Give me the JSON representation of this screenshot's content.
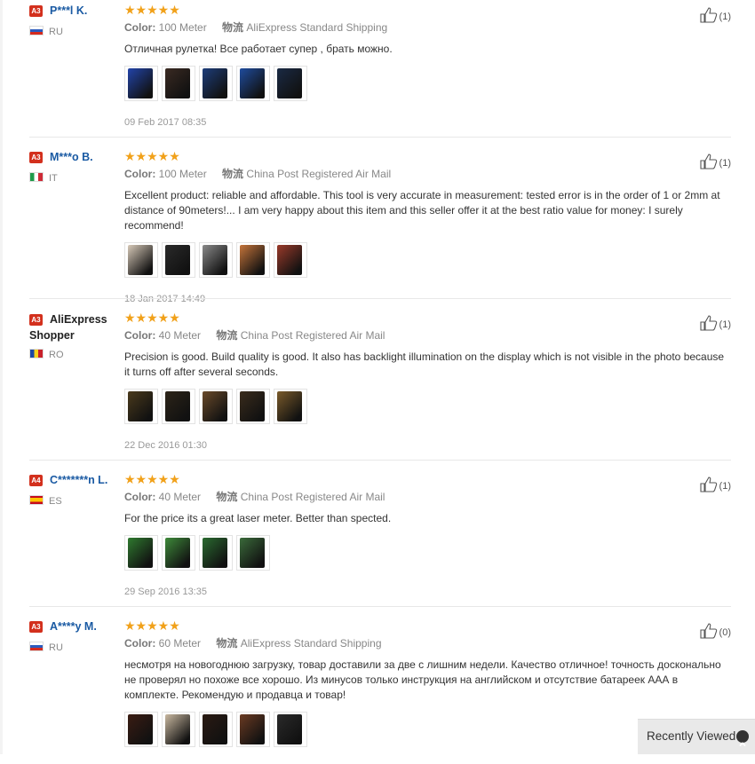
{
  "colors": {
    "star": "#f1a11a",
    "badge": "#d3301d",
    "name": "#1a5aa3",
    "muted": "#888888"
  },
  "reviews": [
    {
      "level": "A3",
      "name": "P***l K.",
      "country": "RU",
      "stars": "★★★★★",
      "color_label": "Color:",
      "color_value": "100 Meter",
      "ship_label": "物流",
      "ship_value": "AliExpress Standard Shipping",
      "text": "Отличная рулетка! Все работает супер , брать можно.",
      "photos": [
        "#2244aa",
        "#3a2a22",
        "#1d3d7a",
        "#1f4c9e",
        "#1a2a44"
      ],
      "date": "09 Feb 2017 08:35",
      "helpful": "(1)"
    },
    {
      "level": "A3",
      "name": "M***o B.",
      "country": "IT",
      "stars": "★★★★★",
      "color_label": "Color:",
      "color_value": "100 Meter",
      "ship_label": "物流",
      "ship_value": "China Post Registered Air Mail",
      "text": "Excellent product: reliable and affordable. This tool is very accurate in measurement: tested error is in the order of 1 or 2mm at distance of 90meters!... I am very happy about this item and this seller offer it at the best ratio value for money: I surely recommend!",
      "photos": [
        "#d7c9b8",
        "#2a2a2a",
        "#8a8a8a",
        "#c4743a",
        "#9a3a2a"
      ],
      "date": "18 Jan 2017 14:49",
      "helpful": "(1)"
    },
    {
      "level": "A3",
      "name": "AliExpress Shopper",
      "country": "RO",
      "stars": "★★★★★",
      "color_label": "Color:",
      "color_value": "40 Meter",
      "ship_label": "物流",
      "ship_value": "China Post Registered Air Mail",
      "text": "Precision is good. Build quality is good. It also has backlight illumination on the display which is not visible in the photo because it turns off after several seconds.",
      "photos": [
        "#4a3a1c",
        "#2c2418",
        "#6a4a2a",
        "#3a2c1c",
        "#7a5a2a"
      ],
      "date": "22 Dec 2016 01:30",
      "helpful": "(1)"
    },
    {
      "level": "A4",
      "name": "C*******n L.",
      "country": "ES",
      "stars": "★★★★★",
      "color_label": "Color:",
      "color_value": "40 Meter",
      "ship_label": "物流",
      "ship_value": "China Post Registered Air Mail",
      "text": "For the price its a great laser meter. Better than spected.",
      "photos": [
        "#2f7a2f",
        "#3e8a3a",
        "#2a6a30",
        "#3a6a3a"
      ],
      "date": "29 Sep 2016 13:35",
      "helpful": "(1)"
    },
    {
      "level": "A3",
      "name": "A****y M.",
      "country": "RU",
      "stars": "★★★★★",
      "color_label": "Color:",
      "color_value": "60 Meter",
      "ship_label": "物流",
      "ship_value": "AliExpress Standard Shipping",
      "text": "несмотря на новогоднюю загрузку, товар доставили за две с лишним недели. Качество отличное! точность досконально не проверял но похоже все хорошо. Из минусов только инструкция на английском и отсутствие батареек ААА в комплекте. Рекомендую и продавца и товар!",
      "photos": [
        "#3a1c12",
        "#c9b8a0",
        "#2a1a12",
        "#6a3a22",
        "#2a2a2a"
      ],
      "date": "",
      "helpful": "(0)"
    }
  ],
  "recently_viewed": {
    "label": "Recently Viewed"
  }
}
